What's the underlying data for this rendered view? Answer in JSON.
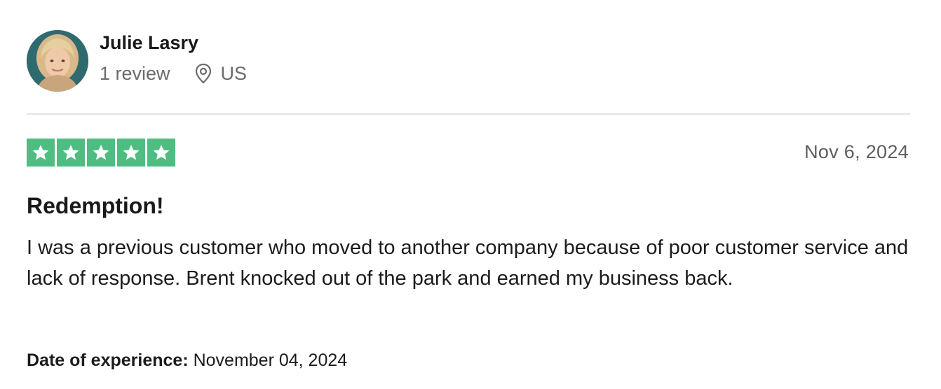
{
  "reviewer": {
    "name": "Julie Lasry",
    "review_count": "1 review",
    "location": "US",
    "avatar_icon": "avatar-photo"
  },
  "review": {
    "rating": 5,
    "rating_max": 5,
    "date": "Nov 6, 2024",
    "title": "Redemption!",
    "body": "I was a previous customer who moved to another company because of poor customer service and lack of response. Brent knocked out of the park and earned my business back.",
    "experience_label": "Date of experience:",
    "experience_date": "November 04, 2024"
  },
  "colors": {
    "star_green": "#4fbd82",
    "divider": "#e3e3e3",
    "meta_gray": "#6b6b6b"
  },
  "icons": {
    "star": "star-icon",
    "location": "location-pin-icon"
  }
}
